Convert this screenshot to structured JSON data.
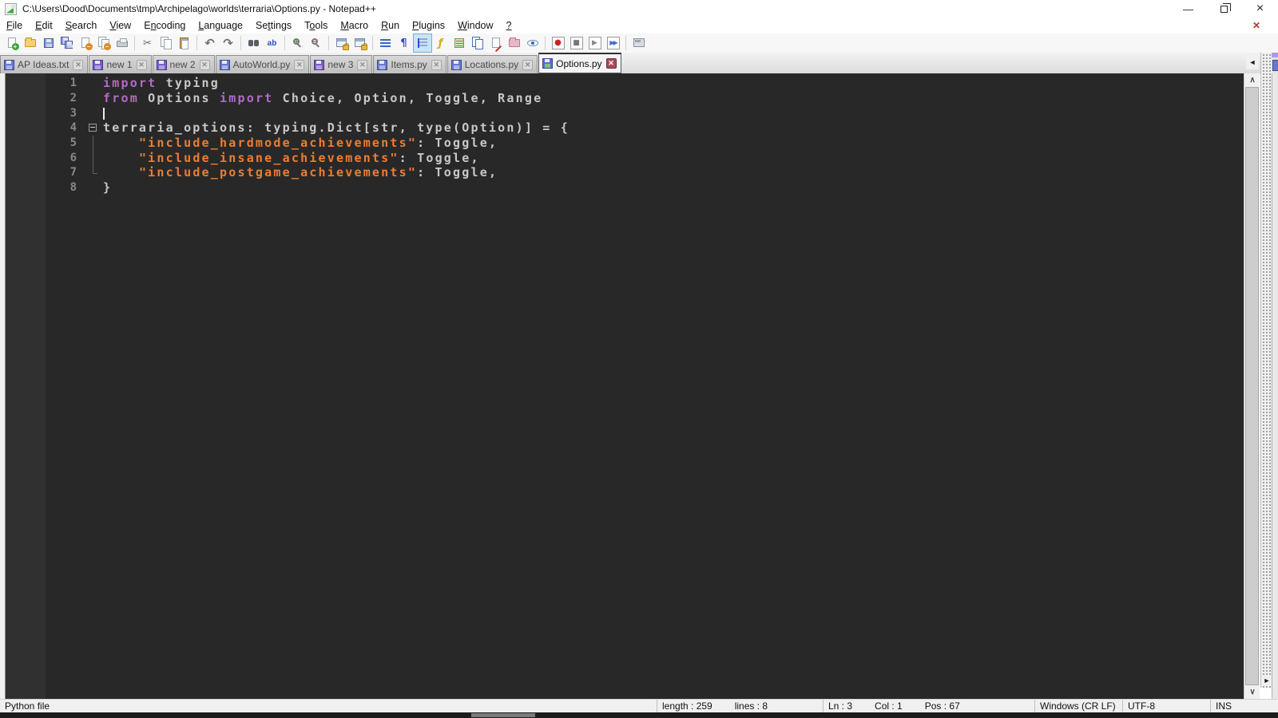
{
  "window": {
    "title": "C:\\Users\\Dood\\Documents\\tmp\\Archipelago\\worlds\\terraria\\Options.py - Notepad++"
  },
  "icons": {
    "minimize": "—",
    "close": "×",
    "menu_close": "✕",
    "cut": "✂",
    "undo": "↶",
    "redo": "↷",
    "pilcrow": "¶",
    "function": "ƒ",
    "record": "●",
    "stop": "■",
    "play": "▶",
    "play_multi": "▶▶",
    "replace": "ab",
    "scroll_up": "∧",
    "scroll_down": "∨",
    "tab_scroll_left": "◄",
    "splitter_arrow": "►"
  },
  "menu": {
    "items": [
      {
        "label": "File",
        "mnemonic": 0
      },
      {
        "label": "Edit",
        "mnemonic": 0
      },
      {
        "label": "Search",
        "mnemonic": 0
      },
      {
        "label": "View",
        "mnemonic": 0
      },
      {
        "label": "Encoding",
        "mnemonic": 1
      },
      {
        "label": "Language",
        "mnemonic": 0
      },
      {
        "label": "Settings",
        "mnemonic": 2
      },
      {
        "label": "Tools",
        "mnemonic": 1
      },
      {
        "label": "Macro",
        "mnemonic": 0
      },
      {
        "label": "Run",
        "mnemonic": 0
      },
      {
        "label": "Plugins",
        "mnemonic": 0
      },
      {
        "label": "Window",
        "mnemonic": 0
      },
      {
        "label": "?",
        "mnemonic": 0
      }
    ]
  },
  "toolbar": {
    "items": [
      {
        "name": "new-file",
        "icon": "new"
      },
      {
        "name": "open-file",
        "icon": "open"
      },
      {
        "name": "save",
        "icon": "save"
      },
      {
        "name": "save-all",
        "icon": "saveall"
      },
      {
        "name": "close",
        "icon": "close"
      },
      {
        "name": "close-all",
        "icon": "closeall"
      },
      {
        "name": "print",
        "icon": "print"
      },
      {
        "name": "sep1",
        "icon": "sep"
      },
      {
        "name": "cut",
        "icon": "cut"
      },
      {
        "name": "copy",
        "icon": "copy"
      },
      {
        "name": "paste",
        "icon": "paste"
      },
      {
        "name": "sep2",
        "icon": "sep"
      },
      {
        "name": "undo",
        "icon": "undo"
      },
      {
        "name": "redo",
        "icon": "redo"
      },
      {
        "name": "sep3",
        "icon": "sep"
      },
      {
        "name": "find",
        "icon": "find"
      },
      {
        "name": "replace",
        "icon": "replace"
      },
      {
        "name": "sep4",
        "icon": "sep"
      },
      {
        "name": "zoom-in",
        "icon": "zoomin"
      },
      {
        "name": "zoom-out",
        "icon": "zoomout"
      },
      {
        "name": "sep5",
        "icon": "sep"
      },
      {
        "name": "sync-scroll-vertical",
        "icon": "syncv"
      },
      {
        "name": "sync-scroll-horizontal",
        "icon": "synch"
      },
      {
        "name": "sep6",
        "icon": "sep"
      },
      {
        "name": "word-wrap",
        "icon": "wrap"
      },
      {
        "name": "show-all-characters",
        "icon": "pilcrow"
      },
      {
        "name": "indent-guide",
        "icon": "indent",
        "active": true
      },
      {
        "name": "function-list",
        "icon": "funclist"
      },
      {
        "name": "document-map",
        "icon": "map"
      },
      {
        "name": "document-list",
        "icon": "doclist"
      },
      {
        "name": "edit-document",
        "icon": "docedit"
      },
      {
        "name": "project-folder",
        "icon": "projfolder"
      },
      {
        "name": "document-monitor",
        "icon": "eye"
      },
      {
        "name": "sep7",
        "icon": "sep"
      },
      {
        "name": "macro-record",
        "icon": "record"
      },
      {
        "name": "macro-stop",
        "icon": "stop"
      },
      {
        "name": "macro-play",
        "icon": "play"
      },
      {
        "name": "macro-run-multiple",
        "icon": "playmulti"
      },
      {
        "name": "sep8",
        "icon": "sep"
      },
      {
        "name": "macro-save",
        "icon": "savemacro"
      }
    ]
  },
  "tabs": [
    {
      "label": "AP Ideas.txt",
      "modified": false,
      "active": false
    },
    {
      "label": "new 1",
      "modified": true,
      "active": false
    },
    {
      "label": "new 2",
      "modified": true,
      "active": false
    },
    {
      "label": "AutoWorld.py",
      "modified": false,
      "active": false
    },
    {
      "label": "new 3",
      "modified": true,
      "active": false
    },
    {
      "label": "Items.py",
      "modified": false,
      "active": false
    },
    {
      "label": "Locations.py",
      "modified": false,
      "active": false
    },
    {
      "label": "Options.py",
      "modified": false,
      "active": true
    }
  ],
  "tab_close_glyph": "✕",
  "editor": {
    "colors": {
      "background": "#282828",
      "margin_background": "#303030",
      "line_number": "#878787",
      "keyword": "#b36bc8",
      "string": "#ed7d31",
      "default_text": "#c8c8c8"
    },
    "lines": [
      {
        "num": "1",
        "fold": "none",
        "cursor": false,
        "segments": [
          {
            "c": "k",
            "t": "import"
          },
          {
            "c": "d",
            "t": " typing"
          }
        ]
      },
      {
        "num": "2",
        "fold": "none",
        "cursor": false,
        "segments": [
          {
            "c": "k",
            "t": "from"
          },
          {
            "c": "d",
            "t": " Options "
          },
          {
            "c": "k",
            "t": "import"
          },
          {
            "c": "d",
            "t": " Choice, Option, Toggle, Range"
          }
        ]
      },
      {
        "num": "3",
        "fold": "none",
        "cursor": true,
        "segments": []
      },
      {
        "num": "4",
        "fold": "box",
        "cursor": false,
        "segments": [
          {
            "c": "d",
            "t": "terraria_options: typing.Dict[str, type(Option)] = {"
          }
        ]
      },
      {
        "num": "5",
        "fold": "line",
        "cursor": false,
        "segments": [
          {
            "c": "d",
            "t": "    "
          },
          {
            "c": "s",
            "t": "\"include_hardmode_achievements\""
          },
          {
            "c": "d",
            "t": ": Toggle,"
          }
        ]
      },
      {
        "num": "6",
        "fold": "line",
        "cursor": false,
        "segments": [
          {
            "c": "d",
            "t": "    "
          },
          {
            "c": "s",
            "t": "\"include_insane_achievements\""
          },
          {
            "c": "d",
            "t": ": Toggle,"
          }
        ]
      },
      {
        "num": "7",
        "fold": "corner",
        "cursor": false,
        "segments": [
          {
            "c": "d",
            "t": "    "
          },
          {
            "c": "s",
            "t": "\"include_postgame_achievements\""
          },
          {
            "c": "d",
            "t": ": Toggle,"
          }
        ]
      },
      {
        "num": "8",
        "fold": "none",
        "cursor": false,
        "segments": [
          {
            "c": "d",
            "t": "}"
          }
        ]
      }
    ]
  },
  "statusbar": {
    "doc_type": "Python file",
    "length": "length : 259",
    "lines": "lines : 8",
    "ln": "Ln : 3",
    "col": "Col : 1",
    "pos": "Pos : 67",
    "eol": "Windows (CR LF)",
    "encoding": "UTF-8",
    "insert_mode": "INS"
  }
}
